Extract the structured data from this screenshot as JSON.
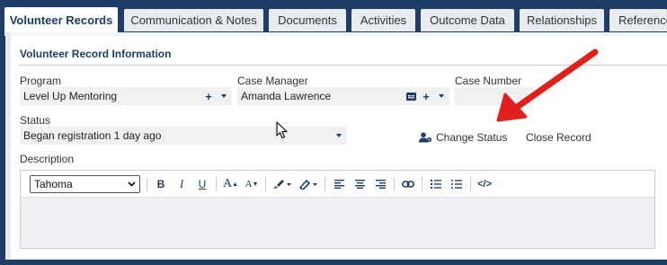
{
  "tabs": [
    {
      "label": "Volunteer Records",
      "active": true
    },
    {
      "label": "Communication & Notes"
    },
    {
      "label": "Documents"
    },
    {
      "label": "Activities"
    },
    {
      "label": "Outcome Data"
    },
    {
      "label": "Relationships"
    },
    {
      "label": "References"
    }
  ],
  "section": {
    "title": "Volunteer Record Information"
  },
  "fields": {
    "program": {
      "label": "Program",
      "value": "Level Up Mentoring"
    },
    "case_manager": {
      "label": "Case Manager",
      "value": "Amanda Lawrence"
    },
    "case_number": {
      "label": "Case Number",
      "value": ""
    },
    "status": {
      "label": "Status",
      "value": "Began registration 1 day ago"
    }
  },
  "actions": {
    "change_status": "Change Status",
    "close_record": "Close Record"
  },
  "description": {
    "label": "Description",
    "font": "Tahoma",
    "toolbar": {
      "bold": "B",
      "italic": "I",
      "underline": "U",
      "font_size_up": "A",
      "font_size_down": "A",
      "source": "</>"
    }
  },
  "colors": {
    "brand": "#1e3e68",
    "annotation_arrow": "#e0201c"
  }
}
